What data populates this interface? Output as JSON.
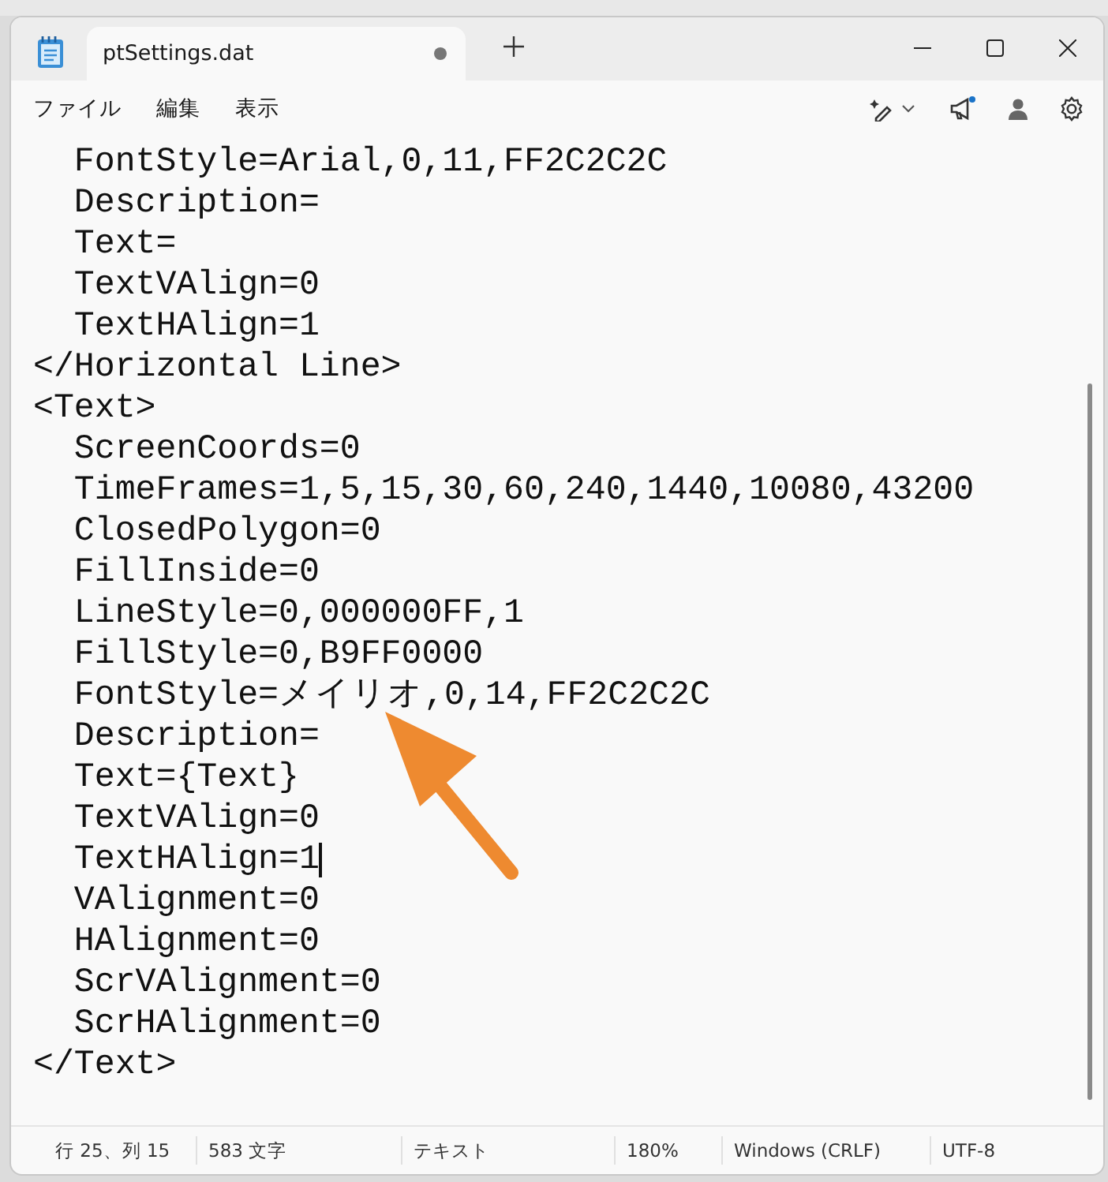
{
  "tab": {
    "title": "ptSettings.dat",
    "modified": true
  },
  "menu": [
    "ファイル",
    "編集",
    "表示"
  ],
  "lines": [
    {
      "text": "  FontStyle=Arial,0,11,FF2C2C2C",
      "cursor": false
    },
    {
      "text": "  Description=",
      "cursor": false
    },
    {
      "text": "  Text=",
      "cursor": false
    },
    {
      "text": "  TextVAlign=0",
      "cursor": false
    },
    {
      "text": "  TextHAlign=1",
      "cursor": false
    },
    {
      "text": "</Horizontal Line>",
      "cursor": false
    },
    {
      "text": "<Text>",
      "cursor": false
    },
    {
      "text": "  ScreenCoords=0",
      "cursor": false
    },
    {
      "text": "  TimeFrames=1,5,15,30,60,240,1440,10080,43200",
      "cursor": false
    },
    {
      "text": "  ClosedPolygon=0",
      "cursor": false
    },
    {
      "text": "  FillInside=0",
      "cursor": false
    },
    {
      "text": "  LineStyle=0,000000FF,1",
      "cursor": false
    },
    {
      "text": "  FillStyle=0,B9FF0000",
      "cursor": false
    },
    {
      "text": "  FontStyle=メイリオ,0,14,FF2C2C2C",
      "cursor": false
    },
    {
      "text": "  Description=",
      "cursor": false
    },
    {
      "text": "  Text={Text}",
      "cursor": false
    },
    {
      "text": "  TextVAlign=0",
      "cursor": false
    },
    {
      "text": "  TextHAlign=1",
      "cursor": true
    },
    {
      "text": "  VAlignment=0",
      "cursor": false
    },
    {
      "text": "  HAlignment=0",
      "cursor": false
    },
    {
      "text": "  ScrVAlignment=0",
      "cursor": false
    },
    {
      "text": "  ScrHAlignment=0",
      "cursor": false
    },
    {
      "text": "</Text>",
      "cursor": false
    }
  ],
  "status_bar": [
    "行 25、列 15",
    "583 文字",
    "テキスト",
    "180%",
    "Windows (CRLF)",
    "UTF-8"
  ]
}
